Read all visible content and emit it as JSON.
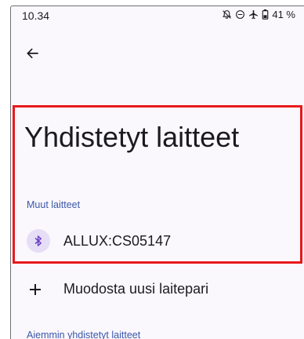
{
  "status_bar": {
    "time": "10.34",
    "battery": "41 %",
    "icons": [
      "notifications-off-icon",
      "do-not-disturb-icon",
      "airplane-mode-icon",
      "battery-icon"
    ]
  },
  "toolbar": {
    "back_icon": "arrow-back-icon"
  },
  "page": {
    "title": "Yhdistetyt laitteet"
  },
  "other_devices": {
    "header": "Muut laitteet",
    "items": [
      {
        "icon": "bluetooth-icon",
        "name": "ALLUX:CS05147"
      }
    ]
  },
  "pair_new": {
    "icon": "plus-icon",
    "label": "Muodosta uusi laitepari"
  },
  "previously_connected": {
    "header": "Aiemmin yhdistetyt laitteet"
  },
  "colors": {
    "background": "#fbf8fd",
    "accent_text": "#3a57a8",
    "bluetooth_circle": "#e6ddf6",
    "highlight_border": "#e8191c"
  }
}
